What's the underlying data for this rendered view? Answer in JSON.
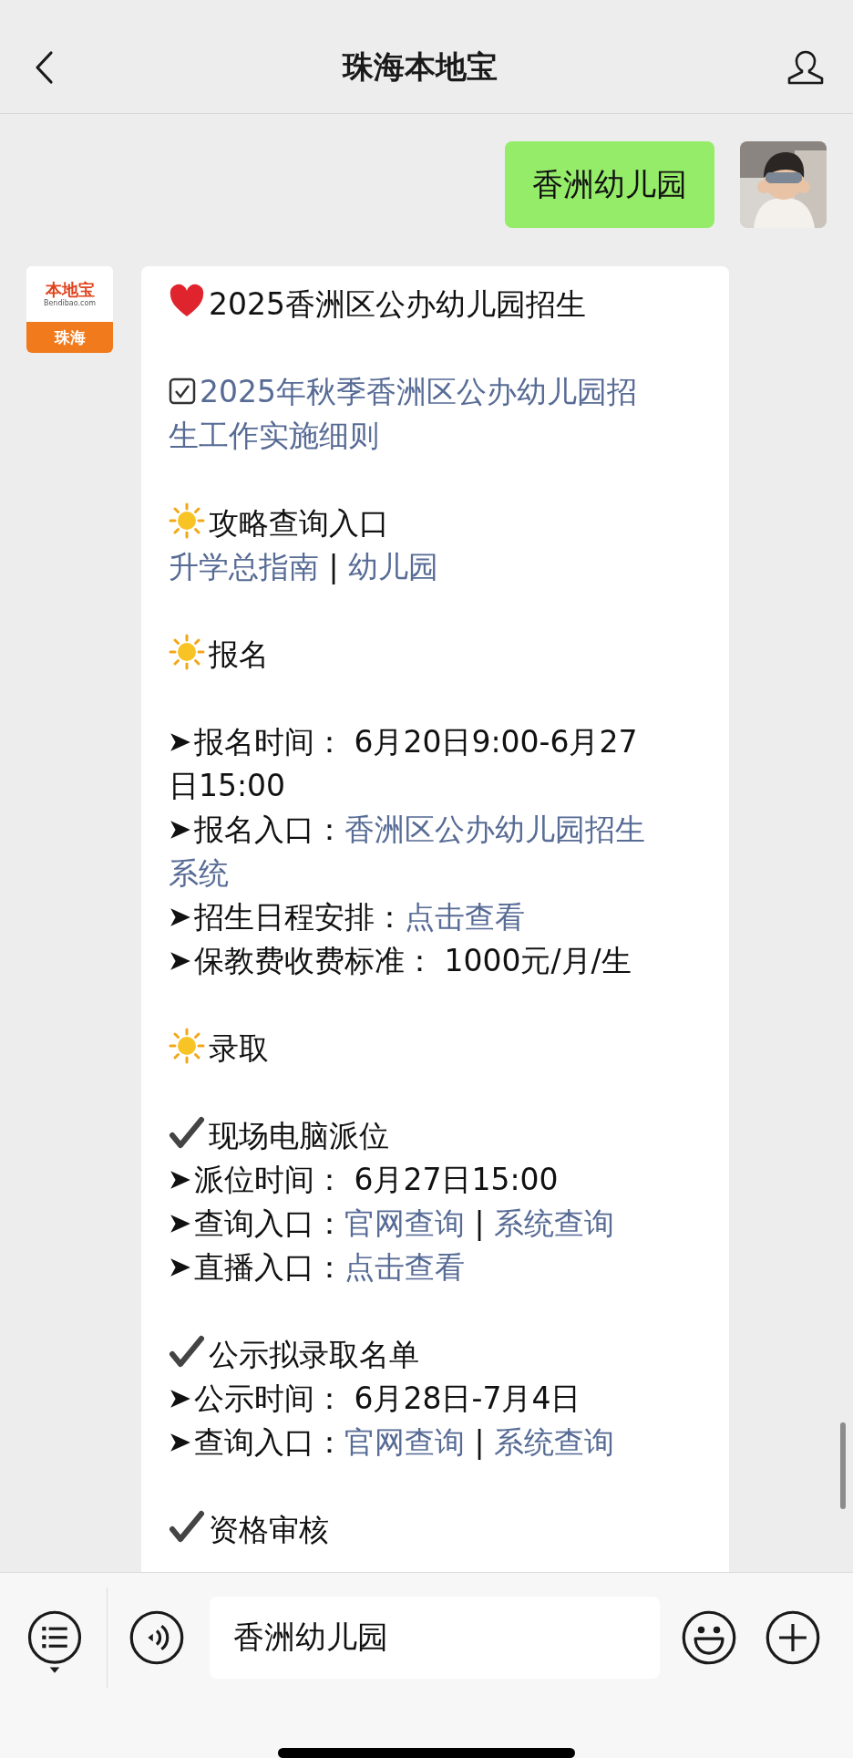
{
  "header": {
    "title": "珠海本地宝"
  },
  "user_message": {
    "text": "香洲幼儿园"
  },
  "bot": {
    "logo": {
      "top": "本地宝",
      "site": "Bendibao.com",
      "bottom": "珠海"
    }
  },
  "bot_message": {
    "lines": [
      {
        "kind": "heart",
        "parts": [
          {
            "text": "2025香洲区公办幼儿园招生",
            "link": false
          }
        ]
      },
      {
        "kind": "blank"
      },
      {
        "kind": "checkbox",
        "parts": [
          {
            "text": "2025年秋季香洲区公办幼儿园招",
            "link": true
          }
        ]
      },
      {
        "kind": "plain",
        "parts": [
          {
            "text": "生工作实施细则",
            "link": true
          }
        ]
      },
      {
        "kind": "blank"
      },
      {
        "kind": "sun",
        "parts": [
          {
            "text": "攻略查询入口",
            "link": false
          }
        ]
      },
      {
        "kind": "plain",
        "parts": [
          {
            "text": "升学总指南",
            "link": true
          },
          {
            "text": " | ",
            "link": false
          },
          {
            "text": "幼儿园",
            "link": true
          }
        ]
      },
      {
        "kind": "blank"
      },
      {
        "kind": "sun",
        "parts": [
          {
            "text": "报名",
            "link": false
          }
        ]
      },
      {
        "kind": "blank"
      },
      {
        "kind": "arrow",
        "parts": [
          {
            "text": "报名时间： 6月20日9:00-6月27",
            "link": false
          }
        ]
      },
      {
        "kind": "plain",
        "parts": [
          {
            "text": "日15:00",
            "link": false
          }
        ]
      },
      {
        "kind": "arrow",
        "parts": [
          {
            "text": "报名入口：",
            "link": false
          },
          {
            "text": "香洲区公办幼儿园招生",
            "link": true
          }
        ]
      },
      {
        "kind": "plain",
        "parts": [
          {
            "text": "系统",
            "link": true
          }
        ]
      },
      {
        "kind": "arrow",
        "parts": [
          {
            "text": "招生日程安排：",
            "link": false
          },
          {
            "text": "点击查看",
            "link": true
          }
        ]
      },
      {
        "kind": "arrow",
        "parts": [
          {
            "text": "保教费收费标准： 1000元/月/生",
            "link": false
          }
        ]
      },
      {
        "kind": "blank"
      },
      {
        "kind": "sun",
        "parts": [
          {
            "text": "录取",
            "link": false
          }
        ]
      },
      {
        "kind": "blank"
      },
      {
        "kind": "check",
        "parts": [
          {
            "text": "现场电脑派位",
            "link": false
          }
        ]
      },
      {
        "kind": "arrow",
        "parts": [
          {
            "text": "派位时间： 6月27日15:00",
            "link": false
          }
        ]
      },
      {
        "kind": "arrow",
        "parts": [
          {
            "text": "查询入口：",
            "link": false
          },
          {
            "text": "官网查询",
            "link": true
          },
          {
            "text": " | ",
            "link": false
          },
          {
            "text": "系统查询",
            "link": true
          }
        ]
      },
      {
        "kind": "arrow",
        "parts": [
          {
            "text": "直播入口：",
            "link": false
          },
          {
            "text": "点击查看",
            "link": true
          }
        ]
      },
      {
        "kind": "blank"
      },
      {
        "kind": "check",
        "parts": [
          {
            "text": "公示拟录取名单",
            "link": false
          }
        ]
      },
      {
        "kind": "arrow",
        "parts": [
          {
            "text": "公示时间： 6月28日-7月4日",
            "link": false
          }
        ]
      },
      {
        "kind": "arrow",
        "parts": [
          {
            "text": "查询入口：",
            "link": false
          },
          {
            "text": "官网查询",
            "link": true
          },
          {
            "text": " | ",
            "link": false
          },
          {
            "text": "系统查询",
            "link": true
          }
        ]
      },
      {
        "kind": "blank"
      },
      {
        "kind": "check",
        "parts": [
          {
            "text": "资格审核",
            "link": false
          }
        ]
      }
    ]
  },
  "input_bar": {
    "value": "香洲幼儿园"
  }
}
